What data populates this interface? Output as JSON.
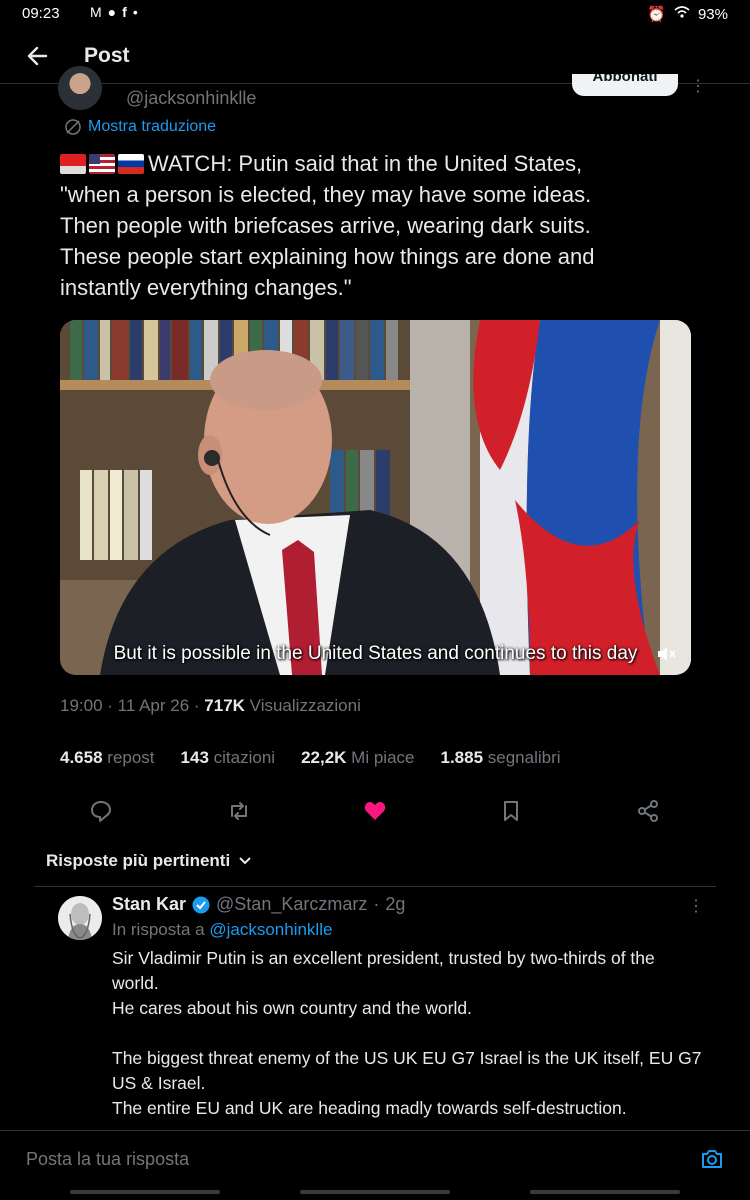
{
  "status_bar": {
    "time": "09:23",
    "battery": "93%"
  },
  "header": {
    "title": "Post"
  },
  "post": {
    "handle": "@jacksonhinklle",
    "follow_label": "Abbonati",
    "translate_label": "Mostra traduzione",
    "text": "WATCH: Putin said that in the United States,\n\"when a person is elected, they may have some ideas.\nThen people with briefcases arrive, wearing dark suits.\nThese people start explaining how things are done and\ninstantly everything changes.\"",
    "video_caption": "But it is possible in the United States and continues to this day",
    "time": "19:00",
    "date": "11 Apr 26",
    "views": "717K",
    "views_label": "Visualizzazioni",
    "reposts": "4.658",
    "reposts_label": "repost",
    "quotes": "143",
    "quotes_label": "citazioni",
    "likes": "22,2K",
    "likes_label": "Mi piace",
    "bookmarks": "1.885",
    "bookmarks_label": "segnalibri",
    "like_color": "#f91880"
  },
  "replies": {
    "sort_label": "Risposte più pertinenti",
    "items": [
      {
        "name": "Stan Kar",
        "handle": "@Stan_Karczmarz",
        "age": "2g",
        "in_reply_prefix": "In risposta a",
        "in_reply_to": "@jacksonhinklle",
        "lines": [
          "Sir Vladimir Putin is an excellent president, trusted by two-thirds of the world.",
          "He cares about his own country and the world.",
          "",
          "The biggest threat enemy of the US UK EU G7 Israel is the UK itself, EU G7 US & Israel.",
          "The entire EU and UK are heading madly towards self-destruction."
        ]
      }
    ]
  },
  "composer": {
    "placeholder": "Posta la tua risposta"
  },
  "colors": {
    "accent": "#1d9bf0",
    "background": "#000000",
    "muted": "#71767b"
  }
}
